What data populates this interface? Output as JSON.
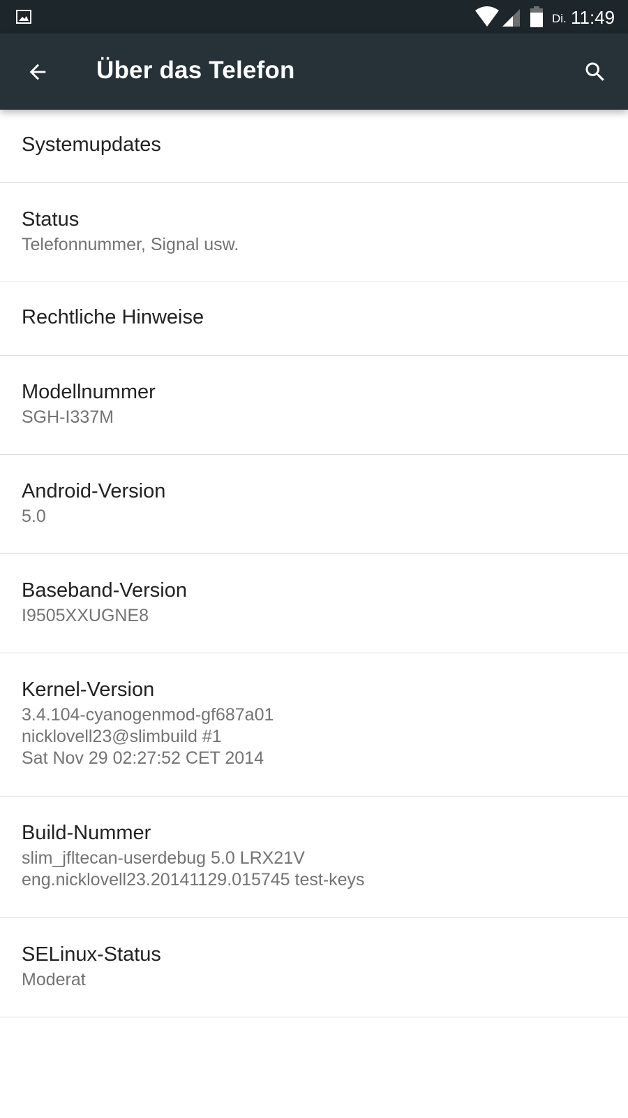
{
  "status_bar": {
    "day": "Di.",
    "time": "11:49",
    "icons": [
      "gallery-icon",
      "wifi-icon",
      "signal-icon",
      "battery-icon"
    ],
    "background_color": "#1d262b"
  },
  "app_bar": {
    "title": "Über das Telefon",
    "back_icon": "arrow-back-icon",
    "search_icon": "search-icon",
    "background_color": "#263238"
  },
  "settings": [
    {
      "title": "Systemupdates",
      "summary": ""
    },
    {
      "title": "Status",
      "summary": "Telefonnummer, Signal usw."
    },
    {
      "title": "Rechtliche Hinweise",
      "summary": ""
    },
    {
      "title": "Modellnummer",
      "summary": "SGH-I337M"
    },
    {
      "title": "Android-Version",
      "summary": "5.0"
    },
    {
      "title": "Baseband-Version",
      "summary": "I9505XXUGNE8"
    },
    {
      "title": "Kernel-Version",
      "summary": "3.4.104-cyanogenmod-gf687a01\nnicklovell23@slimbuild #1\nSat Nov 29 02:27:52 CET 2014"
    },
    {
      "title": "Build-Nummer",
      "summary": "slim_jfltecan-userdebug 5.0 LRX21V\neng.nicklovell23.20141129.015745 test-keys"
    },
    {
      "title": "SELinux-Status",
      "summary": "Moderat"
    }
  ]
}
